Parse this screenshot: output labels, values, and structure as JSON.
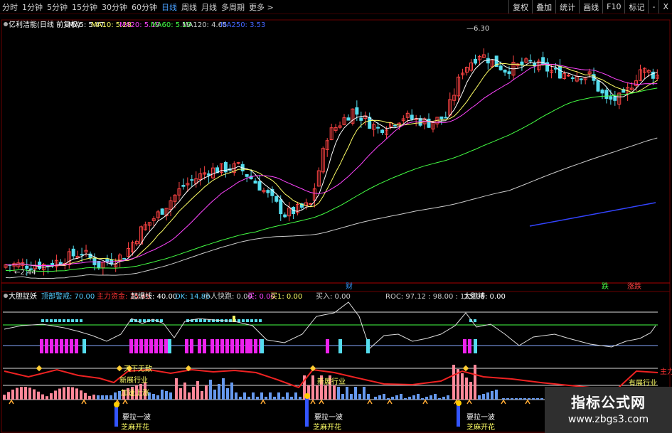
{
  "toolbar": {
    "timeframes": [
      "分时",
      "1分钟",
      "5分钟",
      "15分钟",
      "30分钟",
      "60分钟",
      "日线",
      "周线",
      "月线",
      "多周期",
      "更多 >"
    ],
    "active": "日线",
    "right_buttons": [
      "复权",
      "叠加",
      "统计",
      "画线",
      "F10",
      "标记",
      "-",
      "X"
    ]
  },
  "main_panel": {
    "title": "亿利洁能(日线 前复权)",
    "ma_labels": [
      {
        "text": "MA5: 5.47",
        "color": "#ffffff"
      },
      {
        "text": "MA10: 5.28",
        "color": "#ffff66"
      },
      {
        "text": "MA20: 5.19",
        "color": "#ff44ff"
      },
      {
        "text": "MA60: 5.19",
        "color": "#44ff44"
      },
      {
        "text": "MA120: 4.65",
        "color": "#cccccc"
      },
      {
        "text": "MA250: 3.53",
        "color": "#4466ff"
      }
    ],
    "high_label": "6.30",
    "low_label": "2.44",
    "markers": [
      {
        "text": "财",
        "color": "#3399ff"
      },
      {
        "text": "跌",
        "color": "#44ff44"
      },
      {
        "text": "涨跌",
        "color": "#ff4444"
      }
    ]
  },
  "indicator_panel": {
    "title": "大胆捉妖",
    "labels": [
      {
        "text": "顶部警戒: 70.00",
        "color": "#55ccff"
      },
      {
        "text": "主力资金: 35.45",
        "color": "#ff3333"
      },
      {
        "text": "起爆线: 40.00",
        "color": "#ffffff"
      },
      {
        "text": "DK: 14.86",
        "color": "#55ccff"
      },
      {
        "text": "小人快跑: 0.00",
        "color": "#cccccc"
      },
      {
        "text": "买: 0.00",
        "color": "#ff44ff"
      },
      {
        "text": "买1: 0.00",
        "color": "#ffff66"
      },
      {
        "text": "买入: 0.00",
        "color": "#cccccc"
      },
      {
        "text": "ROC: 97.12 : 98.00 : 115.00",
        "color": "#cccccc"
      },
      {
        "text": "大胆搏: 0.00",
        "color": "#ffffff"
      }
    ],
    "annotations": [
      {
        "text": "天下无敌",
        "color": "#ffff66"
      },
      {
        "text": "新展行业",
        "color": "#ffff66"
      },
      {
        "text": "加速上涨",
        "color": "#ffff66"
      },
      {
        "text": "要拉一波",
        "color": "#ffffff"
      },
      {
        "text": "芝麻开花",
        "color": "#ffff66"
      },
      {
        "text": "新展行业",
        "color": "#ffff66"
      },
      {
        "text": "要拉一波",
        "color": "#ffffff"
      },
      {
        "text": "芝麻开花",
        "color": "#ffff66"
      },
      {
        "text": "要拉一波",
        "color": "#ffffff"
      },
      {
        "text": "芝麻开花",
        "color": "#ffff66"
      },
      {
        "text": "有展行业",
        "color": "#ffff66"
      },
      {
        "text": "主力",
        "color": "#ff3333"
      }
    ]
  },
  "watermark": {
    "line1": "指标公式网",
    "line2": "www.zbgs3.com"
  },
  "colors": {
    "up": "#ff4444",
    "down": "#55ddee",
    "bg": "#000000",
    "grid": "#6a0000"
  }
}
